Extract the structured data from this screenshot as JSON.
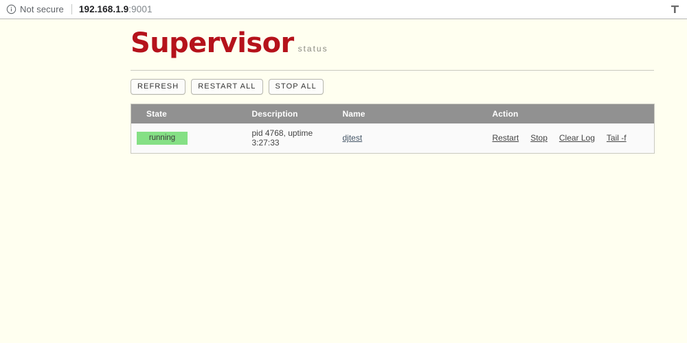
{
  "browser": {
    "security_icon": "info-circle-icon",
    "security_label": "Not secure",
    "url_host": "192.168.1.9",
    "url_port": ":9001",
    "right_icon": "toolbar-icon"
  },
  "header": {
    "logo_main": "Supervisor",
    "logo_sub": "status"
  },
  "toolbar": {
    "buttons": [
      {
        "label": "REFRESH",
        "name": "refresh-button"
      },
      {
        "label": "RESTART ALL",
        "name": "restart-all-button"
      },
      {
        "label": "STOP ALL",
        "name": "stop-all-button"
      }
    ]
  },
  "table": {
    "columns": [
      "State",
      "Description",
      "Name",
      "Action"
    ],
    "rows": [
      {
        "state": "running",
        "state_color": "#85e085",
        "description": "pid 4768, uptime 3:27:33",
        "name": "djtest",
        "actions": [
          "Restart",
          "Stop",
          "Clear Log",
          "Tail -f"
        ]
      }
    ]
  },
  "colors": {
    "page_background": "#fffff0",
    "logo_red": "#b5121b",
    "header_gray": "#919191",
    "row_background": "#fafafa",
    "running_green": "#85e085"
  }
}
